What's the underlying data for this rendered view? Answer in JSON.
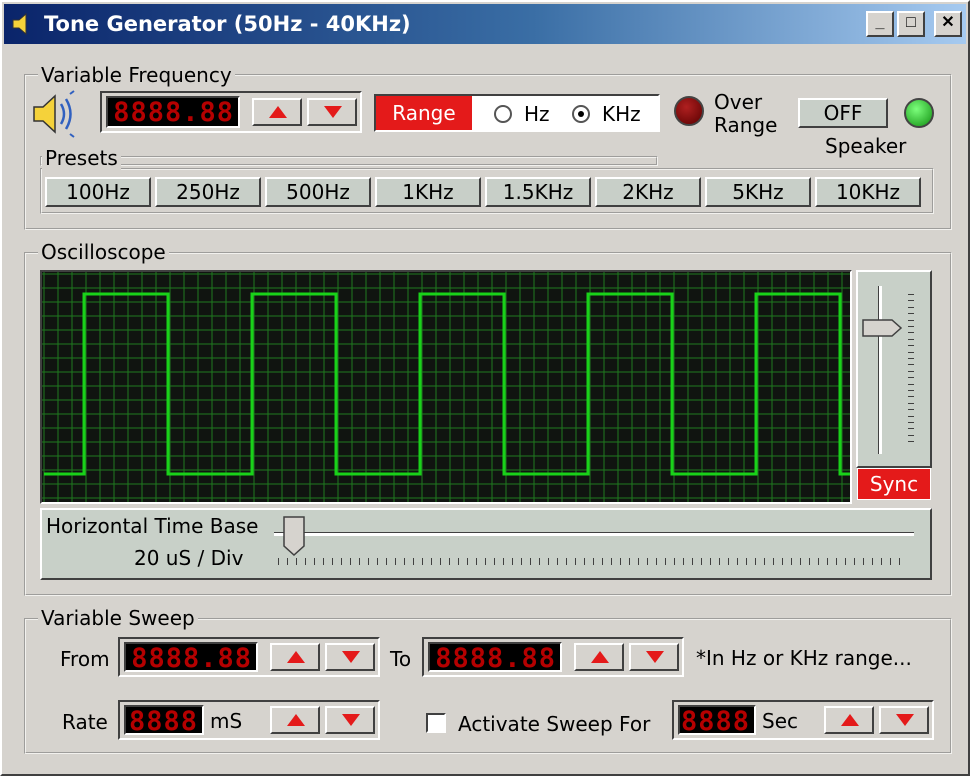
{
  "window": {
    "title": "Tone Generator (50Hz - 40KHz)"
  },
  "title_buttons": {
    "minimize": "_",
    "maximize": "□",
    "close": "✕"
  },
  "variable_frequency": {
    "legend": "Variable Frequency",
    "display": "8888.88",
    "range_button": "Range",
    "hz_label": "Hz",
    "khz_label": "KHz",
    "selected_unit": "KHz",
    "over_range_line1": "Over",
    "over_range_line2": "Range",
    "speaker_toggle": "OFF",
    "speaker_label": "Speaker"
  },
  "presets": {
    "legend": "Presets",
    "items": [
      "100Hz",
      "250Hz",
      "500Hz",
      "1KHz",
      "1.5KHz",
      "2KHz",
      "5KHz",
      "10KHz"
    ]
  },
  "oscilloscope": {
    "legend": "Oscilloscope",
    "sync_button": "Sync",
    "time_base_label": "Horizontal Time Base",
    "time_base_value": "20 uS / Div",
    "trace_color": "#19d219",
    "grid_color": "#1f7a1f",
    "vertical_slider_level": 0.78,
    "time_base_level": 0.02
  },
  "variable_sweep": {
    "legend": "Variable Sweep",
    "from_label": "From",
    "from_display": "8888.88",
    "to_label": "To",
    "to_display": "8888.88",
    "note": "*In Hz or KHz range...",
    "rate_label": "Rate",
    "rate_display": "8888",
    "rate_unit": "mS",
    "activate_label": "Activate Sweep  For",
    "activate_checked": false,
    "for_display": "8888",
    "for_unit": "Sec"
  },
  "colors": {
    "accent_red": "#e41a1a",
    "led_dark_red": "#7a0000",
    "led_green": "#1ec81e"
  }
}
